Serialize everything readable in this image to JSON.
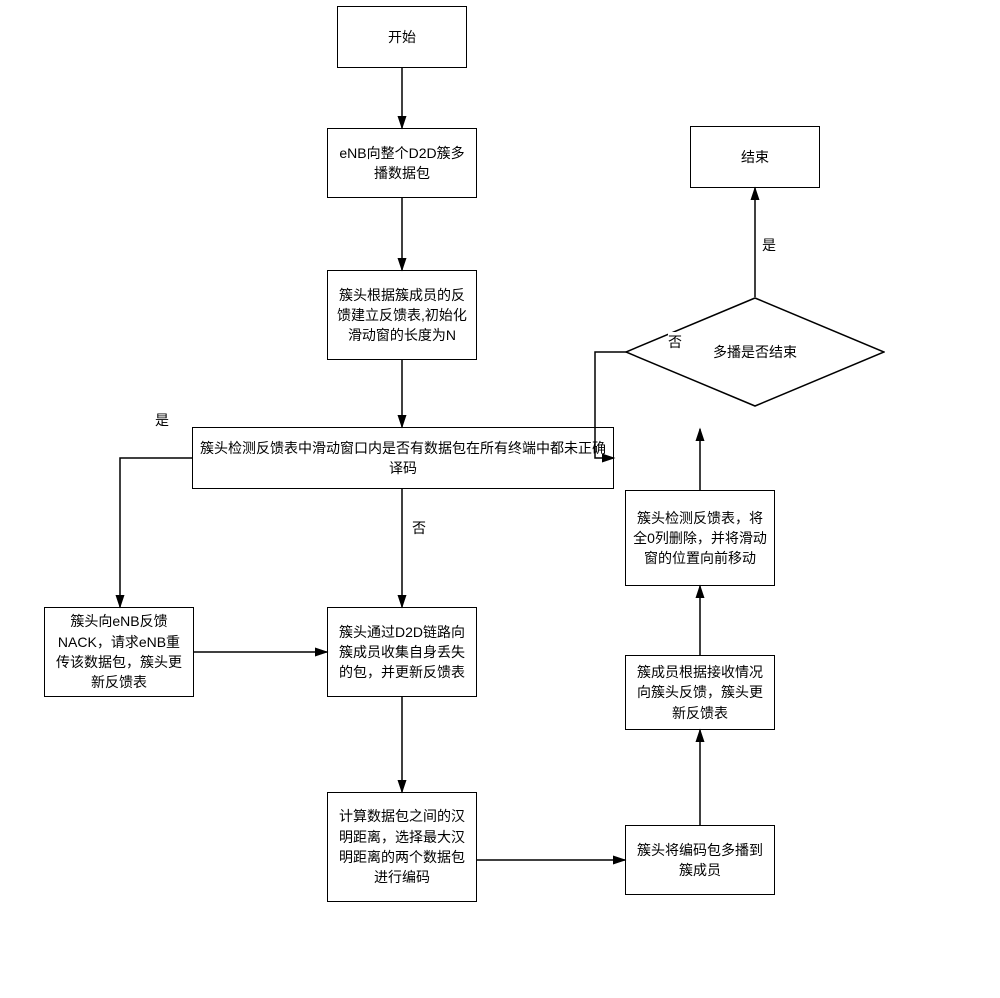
{
  "nodes": {
    "start": "开始",
    "enb_multicast": "eNB向整个D2D簇多播数据包",
    "init_feedback": "簇头根据簇成员的反馈建立反馈表,初始化滑动窗的长度为N",
    "decision_decode": "簇头检测反馈表中滑动窗口内是否有数据包在所有终端中都未正确译码",
    "nack": "簇头向eNB反馈NACK，请求eNB重传该数据包，簇头更新反馈表",
    "collect_lost": "簇头通过D2D链路向簇成员收集自身丢失的包，并更新反馈表",
    "hamming": "计算数据包之间的汉明距离，选择最大汉明距离的两个数据包进行编码",
    "multicast_encoded": "簇头将编码包多播到簇成员",
    "member_feedback": "簇成员根据接收情况向簇头反馈，簇头更新反馈表",
    "slide_window": "簇头检测反馈表，将全0列删除，并将滑动窗的位置向前移动",
    "decision_end": "多播是否结束",
    "end": "结束"
  },
  "labels": {
    "yes": "是",
    "no": "否"
  }
}
